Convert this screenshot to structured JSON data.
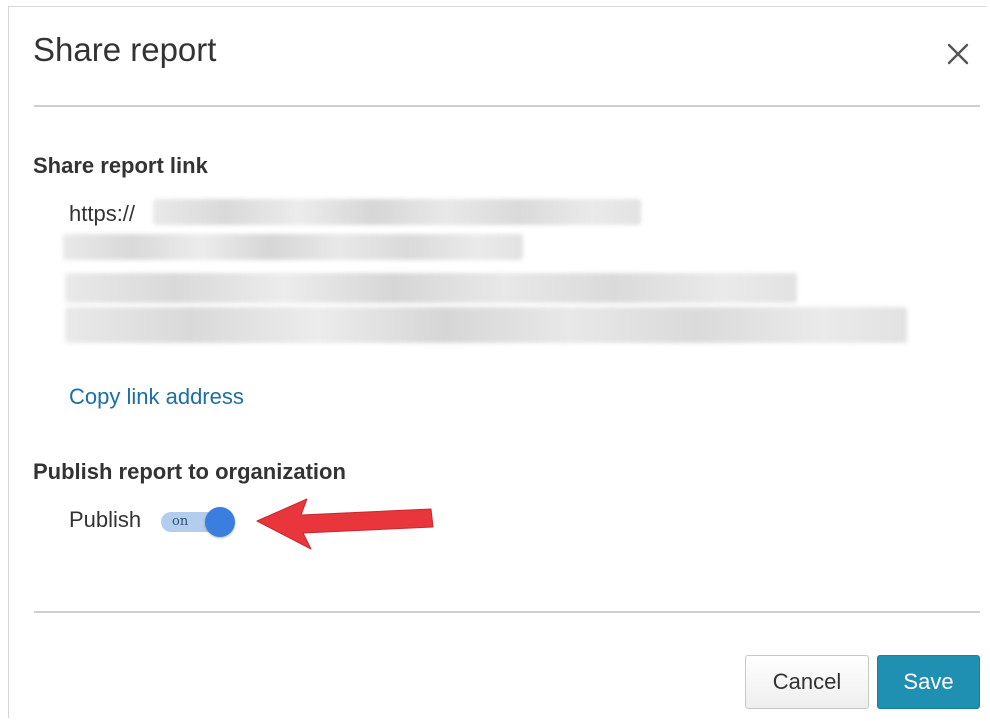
{
  "dialog": {
    "title": "Share report",
    "close_icon": "close-icon"
  },
  "share_link": {
    "section_title": "Share report link",
    "url_prefix": "https://",
    "copy_label": "Copy link address"
  },
  "publish": {
    "section_title": "Publish report to organization",
    "label": "Publish",
    "toggle_text": "on",
    "toggle_state": "on"
  },
  "annotation": {
    "arrow_icon": "red-arrow-icon",
    "color": "#e8363c"
  },
  "footer": {
    "cancel_label": "Cancel",
    "save_label": "Save"
  },
  "colors": {
    "link": "#1a6fa6",
    "primary_button": "#1f8fb2",
    "toggle_knob": "#3a7fdf",
    "toggle_track": "#b3cdef"
  }
}
